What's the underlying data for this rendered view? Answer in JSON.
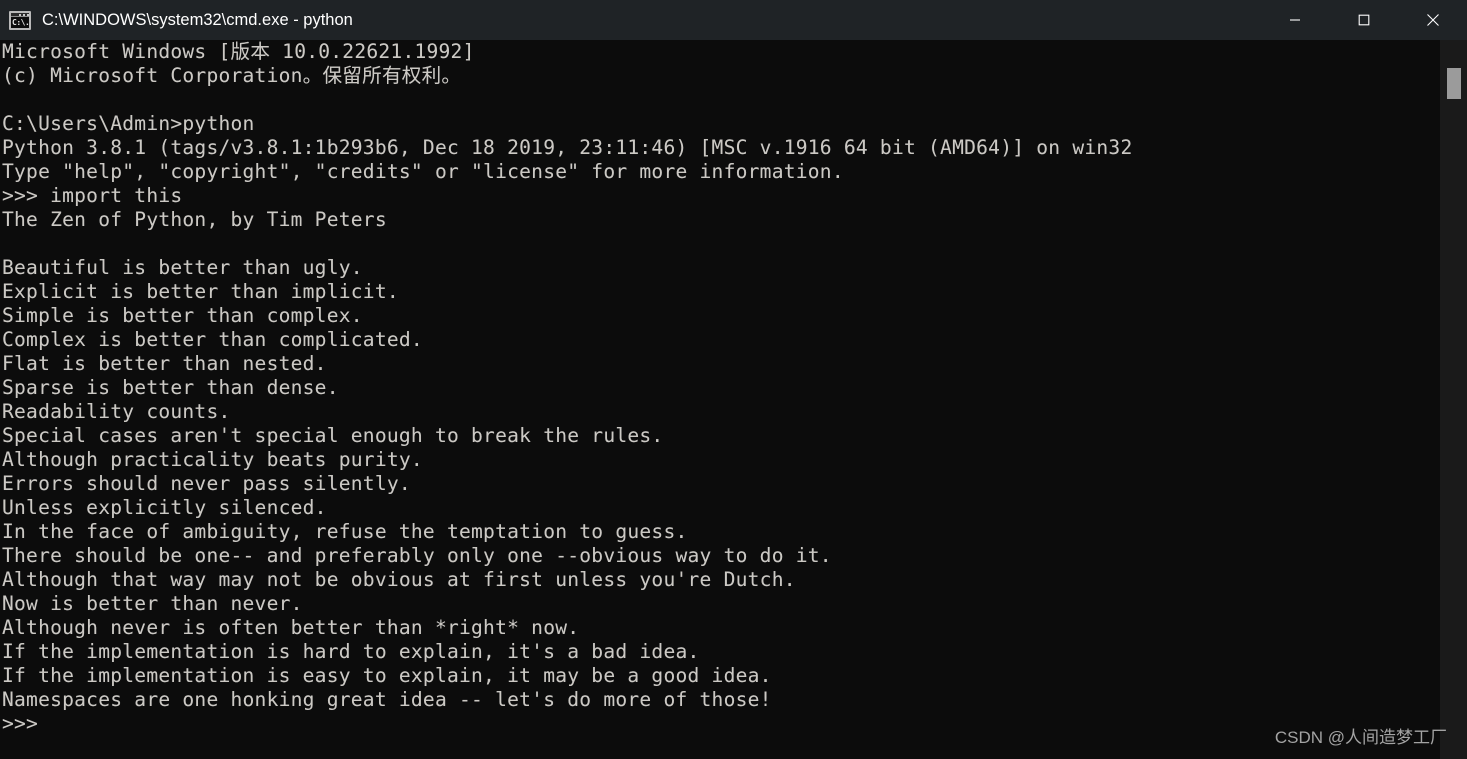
{
  "window": {
    "title": "C:\\WINDOWS\\system32\\cmd.exe - python",
    "icon": "cmd-console-icon",
    "icon_prompt_text": "C:\\.",
    "titlebar_color": "#1f2326",
    "console_background": "#0c0c0c",
    "console_foreground": "#ccc9c4"
  },
  "titlebar_buttons": {
    "minimize": "minimize-icon",
    "maximize": "maximize-icon",
    "close": "close-icon"
  },
  "scrollbar": {
    "track_color": "#1a1a1a",
    "thumb_color": "#9b9b9b"
  },
  "watermark": {
    "text": "CSDN @人间造梦工厂"
  },
  "console": {
    "lines": [
      "Microsoft Windows [版本 10.0.22621.1992]",
      "(c) Microsoft Corporation。保留所有权利。",
      "",
      "C:\\Users\\Admin>python",
      "Python 3.8.1 (tags/v3.8.1:1b293b6, Dec 18 2019, 23:11:46) [MSC v.1916 64 bit (AMD64)] on win32",
      "Type \"help\", \"copyright\", \"credits\" or \"license\" for more information.",
      ">>> import this",
      "The Zen of Python, by Tim Peters",
      "",
      "Beautiful is better than ugly.",
      "Explicit is better than implicit.",
      "Simple is better than complex.",
      "Complex is better than complicated.",
      "Flat is better than nested.",
      "Sparse is better than dense.",
      "Readability counts.",
      "Special cases aren't special enough to break the rules.",
      "Although practicality beats purity.",
      "Errors should never pass silently.",
      "Unless explicitly silenced.",
      "In the face of ambiguity, refuse the temptation to guess.",
      "There should be one-- and preferably only one --obvious way to do it.",
      "Although that way may not be obvious at first unless you're Dutch.",
      "Now is better than never.",
      "Although never is often better than *right* now.",
      "If the implementation is hard to explain, it's a bad idea.",
      "If the implementation is easy to explain, it may be a good idea.",
      "Namespaces are one honking great idea -- let's do more of those!",
      ">>>"
    ],
    "text": "Microsoft Windows [版本 10.0.22621.1992]\n(c) Microsoft Corporation。保留所有权利。\n\nC:\\Users\\Admin>python\nPython 3.8.1 (tags/v3.8.1:1b293b6, Dec 18 2019, 23:11:46) [MSC v.1916 64 bit (AMD64)] on win32\nType \"help\", \"copyright\", \"credits\" or \"license\" for more information.\n>>> import this\nThe Zen of Python, by Tim Peters\n\nBeautiful is better than ugly.\nExplicit is better than implicit.\nSimple is better than complex.\nComplex is better than complicated.\nFlat is better than nested.\nSparse is better than dense.\nReadability counts.\nSpecial cases aren't special enough to break the rules.\nAlthough practicality beats purity.\nErrors should never pass silently.\nUnless explicitly silenced.\nIn the face of ambiguity, refuse the temptation to guess.\nThere should be one-- and preferably only one --obvious way to do it.\nAlthough that way may not be obvious at first unless you're Dutch.\nNow is better than never.\nAlthough never is often better than *right* now.\nIf the implementation is hard to explain, it's a bad idea.\nIf the implementation is easy to explain, it may be a good idea.\nNamespaces are one honking great idea -- let's do more of those!\n>>>"
  }
}
